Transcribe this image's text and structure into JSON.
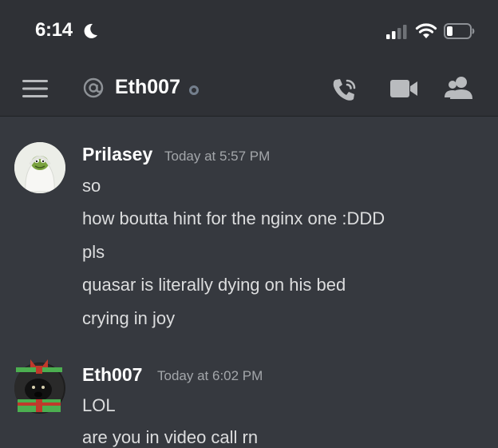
{
  "status_bar": {
    "time": "6:14",
    "icons": [
      "moon-icon",
      "cellular-signal-icon",
      "wifi-icon",
      "battery-icon"
    ]
  },
  "header": {
    "channel_icon": "at-icon",
    "channel_name": "Eth007",
    "presence": "offline",
    "actions": [
      "menu-icon",
      "call-icon",
      "video-icon",
      "members-icon"
    ]
  },
  "messages": [
    {
      "author": "Prilasey",
      "timestamp": "Today at 5:57 PM",
      "avatar": "kermit-avatar",
      "lines": [
        "so",
        "how boutta hint for the nginx one :DDD",
        "pls",
        "quasar is literally dying on his bed",
        "crying in joy"
      ]
    },
    {
      "author": "Eth007",
      "timestamp": "Today at 6:02 PM",
      "avatar": "dog-gift-avatar",
      "lines": [
        "LOL",
        "are you in video call rn"
      ]
    }
  ],
  "colors": {
    "background": "#36393f",
    "header": "#2f3136",
    "text": "#dcddde",
    "muted": "#a3a6aa",
    "offline": "#747f8d"
  }
}
